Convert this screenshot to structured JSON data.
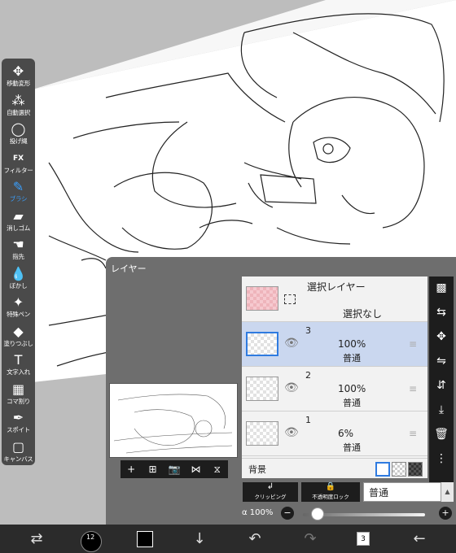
{
  "toolbar": {
    "tools": [
      {
        "label": "移動変形",
        "icon": "move-arrows-icon",
        "glyph": "✥",
        "active": false
      },
      {
        "label": "自動選択",
        "icon": "magic-wand-icon",
        "glyph": "⁂",
        "active": false
      },
      {
        "label": "投げ縄",
        "icon": "lasso-icon",
        "glyph": "◯",
        "active": false
      },
      {
        "label": "フィルター",
        "icon": "fx-icon",
        "glyph": "FX",
        "active": false
      },
      {
        "label": "ブラシ",
        "icon": "brush-icon",
        "glyph": "✎",
        "active": true
      },
      {
        "label": "消しゴム",
        "icon": "eraser-icon",
        "glyph": "▰",
        "active": false
      },
      {
        "label": "指先",
        "icon": "finger-icon",
        "glyph": "☚",
        "active": false
      },
      {
        "label": "ぼかし",
        "icon": "blur-drop-icon",
        "glyph": "💧",
        "active": false
      },
      {
        "label": "特殊ペン",
        "icon": "special-pen-icon",
        "glyph": "✦",
        "active": false
      },
      {
        "label": "塗りつぶし",
        "icon": "fill-bucket-icon",
        "glyph": "◆",
        "active": false
      },
      {
        "label": "文字入れ",
        "icon": "text-icon",
        "glyph": "T",
        "active": false
      },
      {
        "label": "コマ割り",
        "icon": "frame-divider-icon",
        "glyph": "▦",
        "active": false
      },
      {
        "label": "スポイト",
        "icon": "eyedropper-icon",
        "glyph": "✒",
        "active": false
      },
      {
        "label": "キャンバス",
        "icon": "canvas-icon",
        "glyph": "▢",
        "active": false
      }
    ]
  },
  "layer_panel": {
    "title": "レイヤー",
    "selection_layer": {
      "title": "選択レイヤー",
      "status": "選択なし"
    },
    "layers": [
      {
        "number": "3",
        "opacity": "100%",
        "blend": "普通",
        "selected": true
      },
      {
        "number": "2",
        "opacity": "100%",
        "blend": "普通",
        "selected": false
      },
      {
        "number": "1",
        "opacity": "6%",
        "blend": "普通",
        "selected": false
      }
    ],
    "background_label": "背景",
    "clipping_label": "クリッピング",
    "lock_label": "不透明度ロック",
    "blend_mode": "普通",
    "alpha_label": "α",
    "opacity_value": "100%",
    "opacity_fraction": 1.0,
    "minus_label": "−",
    "plus_label": "+"
  },
  "bottom_bar": {
    "brush_size": "12",
    "layer_count": "3"
  }
}
